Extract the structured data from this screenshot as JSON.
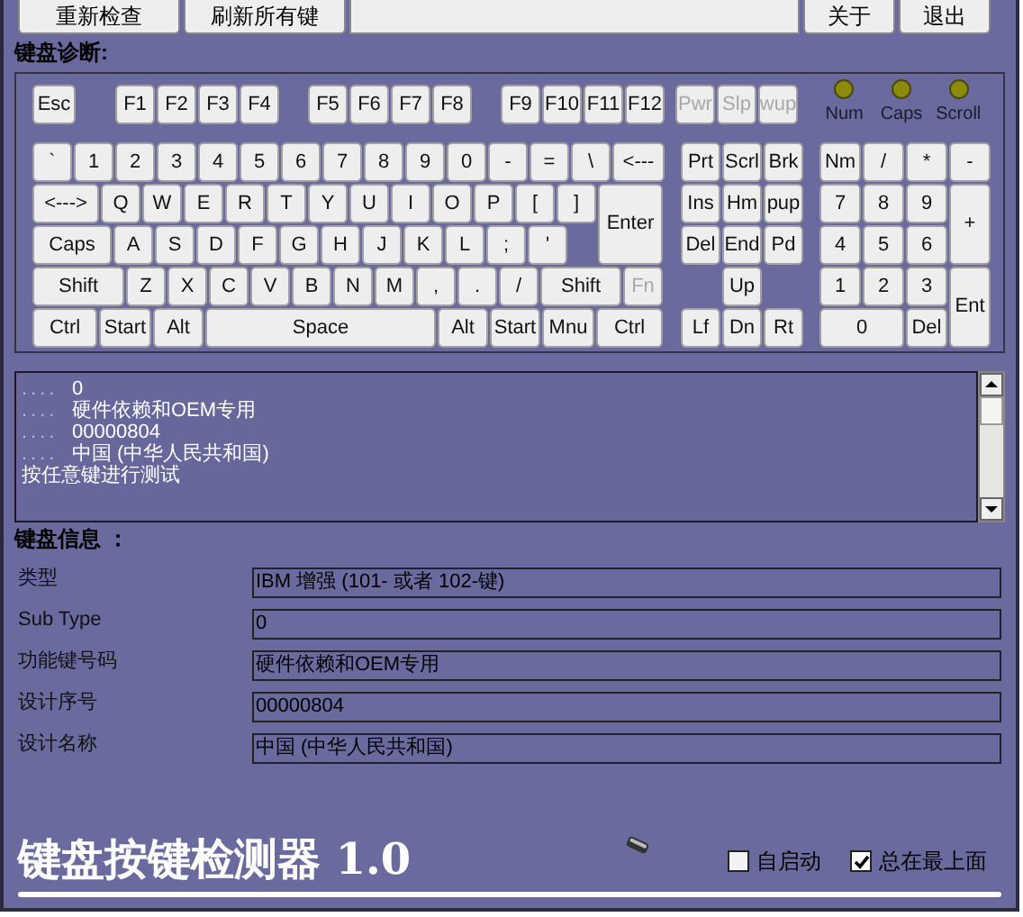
{
  "toolbar": {
    "left_buttons": [
      "重新检查",
      "刷新所有键"
    ],
    "right_buttons": [
      "关于",
      "退出"
    ]
  },
  "diagnostics": {
    "title": "键盘诊断:",
    "function_row": [
      {
        "label": "Esc",
        "disabled": false
      },
      {
        "label": "F1",
        "disabled": false
      },
      {
        "label": "F2",
        "disabled": false
      },
      {
        "label": "F3",
        "disabled": false
      },
      {
        "label": "F4",
        "disabled": false
      },
      {
        "label": "F5",
        "disabled": false
      },
      {
        "label": "F6",
        "disabled": false
      },
      {
        "label": "F7",
        "disabled": false
      },
      {
        "label": "F8",
        "disabled": false
      },
      {
        "label": "F9",
        "disabled": false
      },
      {
        "label": "F10",
        "disabled": false
      },
      {
        "label": "F11",
        "disabled": false
      },
      {
        "label": "F12",
        "disabled": false
      },
      {
        "label": "Pwr",
        "disabled": true
      },
      {
        "label": "Slp",
        "disabled": true
      },
      {
        "label": "wup",
        "disabled": true
      }
    ],
    "indicators": [
      "Num",
      "Caps",
      "Scroll"
    ],
    "main_rows": [
      [
        {
          "label": "`",
          "disabled": false
        },
        {
          "label": "1",
          "disabled": false
        },
        {
          "label": "2",
          "disabled": false
        },
        {
          "label": "3",
          "disabled": false
        },
        {
          "label": "4",
          "disabled": false
        },
        {
          "label": "5",
          "disabled": false
        },
        {
          "label": "6",
          "disabled": false
        },
        {
          "label": "7",
          "disabled": false
        },
        {
          "label": "8",
          "disabled": false
        },
        {
          "label": "9",
          "disabled": false
        },
        {
          "label": "0",
          "disabled": false
        },
        {
          "label": "-",
          "disabled": false
        },
        {
          "label": "=",
          "disabled": false
        },
        {
          "label": "\\",
          "disabled": false
        },
        {
          "label": "<---",
          "disabled": false
        }
      ],
      [
        {
          "label": "<--->",
          "disabled": false
        },
        {
          "label": "Q",
          "disabled": false
        },
        {
          "label": "W",
          "disabled": false
        },
        {
          "label": "E",
          "disabled": false
        },
        {
          "label": "R",
          "disabled": false
        },
        {
          "label": "T",
          "disabled": false
        },
        {
          "label": "Y",
          "disabled": false
        },
        {
          "label": "U",
          "disabled": false
        },
        {
          "label": "I",
          "disabled": false
        },
        {
          "label": "O",
          "disabled": false
        },
        {
          "label": "P",
          "disabled": false
        },
        {
          "label": "[",
          "disabled": false
        },
        {
          "label": "]",
          "disabled": false
        },
        {
          "label": "Enter",
          "disabled": false
        }
      ],
      [
        {
          "label": "Caps",
          "disabled": false
        },
        {
          "label": "A",
          "disabled": false
        },
        {
          "label": "S",
          "disabled": false
        },
        {
          "label": "D",
          "disabled": false
        },
        {
          "label": "F",
          "disabled": false
        },
        {
          "label": "G",
          "disabled": false
        },
        {
          "label": "H",
          "disabled": false
        },
        {
          "label": "J",
          "disabled": false
        },
        {
          "label": "K",
          "disabled": false
        },
        {
          "label": "L",
          "disabled": false
        },
        {
          "label": ";",
          "disabled": false
        },
        {
          "label": "'",
          "disabled": false
        }
      ],
      [
        {
          "label": "Shift",
          "disabled": false
        },
        {
          "label": "Z",
          "disabled": false
        },
        {
          "label": "X",
          "disabled": false
        },
        {
          "label": "C",
          "disabled": false
        },
        {
          "label": "V",
          "disabled": false
        },
        {
          "label": "B",
          "disabled": false
        },
        {
          "label": "N",
          "disabled": false
        },
        {
          "label": "M",
          "disabled": false
        },
        {
          "label": ",",
          "disabled": false
        },
        {
          "label": ".",
          "disabled": false
        },
        {
          "label": "/",
          "disabled": false
        },
        {
          "label": "Shift",
          "disabled": false
        },
        {
          "label": "Fn",
          "disabled": true
        }
      ],
      [
        {
          "label": "Ctrl",
          "disabled": false
        },
        {
          "label": "Start",
          "disabled": false
        },
        {
          "label": "Alt",
          "disabled": false
        },
        {
          "label": "Space",
          "disabled": false
        },
        {
          "label": "Alt",
          "disabled": false
        },
        {
          "label": "Start",
          "disabled": false
        },
        {
          "label": "Mnu",
          "disabled": false
        },
        {
          "label": "Ctrl",
          "disabled": false
        }
      ]
    ],
    "nav_keys": [
      {
        "label": "Prt",
        "disabled": false
      },
      {
        "label": "Scrl",
        "disabled": false
      },
      {
        "label": "Brk",
        "disabled": false
      },
      {
        "label": "Ins",
        "disabled": false
      },
      {
        "label": "Hm",
        "disabled": false
      },
      {
        "label": "pup",
        "disabled": false
      },
      {
        "label": "Del",
        "disabled": false
      },
      {
        "label": "End",
        "disabled": false
      },
      {
        "label": "Pd",
        "disabled": false
      },
      {
        "label": "Up",
        "disabled": false
      },
      {
        "label": "Lf",
        "disabled": false
      },
      {
        "label": "Dn",
        "disabled": false
      },
      {
        "label": "Rt",
        "disabled": false
      }
    ],
    "numpad_keys": [
      {
        "label": "Nm",
        "disabled": false
      },
      {
        "label": "/",
        "disabled": false
      },
      {
        "label": "*",
        "disabled": false
      },
      {
        "label": "-",
        "disabled": false
      },
      {
        "label": "7",
        "disabled": false
      },
      {
        "label": "8",
        "disabled": false
      },
      {
        "label": "9",
        "disabled": false
      },
      {
        "label": "+",
        "disabled": false
      },
      {
        "label": "4",
        "disabled": false
      },
      {
        "label": "5",
        "disabled": false
      },
      {
        "label": "6",
        "disabled": false
      },
      {
        "label": "1",
        "disabled": false
      },
      {
        "label": "2",
        "disabled": false
      },
      {
        "label": "3",
        "disabled": false
      },
      {
        "label": "Ent",
        "disabled": false
      },
      {
        "label": "0",
        "disabled": false
      },
      {
        "label": "Del",
        "disabled": false
      }
    ]
  },
  "log": {
    "lines": [
      {
        "prefix": "....",
        "text": "0"
      },
      {
        "prefix": "....",
        "text": "硬件依赖和OEM专用"
      },
      {
        "prefix": "....",
        "text": "00000804"
      },
      {
        "prefix": "....",
        "text": "中国 (中华人民共和国)"
      },
      {
        "text": "按任意键进行测试"
      }
    ]
  },
  "info": {
    "title": "键盘信息 ：",
    "rows": [
      {
        "label": "类型",
        "value": "IBM 增强 (101- 或者 102-键)"
      },
      {
        "label": "Sub Type",
        "value": "0"
      },
      {
        "label": "功能键号码",
        "value": "硬件依赖和OEM专用"
      },
      {
        "label": "设计序号",
        "value": "00000804"
      },
      {
        "label": "设计名称",
        "value": "中国 (中华人民共和国)"
      }
    ]
  },
  "footer": {
    "app_title": "键盘按键检测器 1.0",
    "checkboxes": [
      {
        "label": "自启动",
        "checked": false
      },
      {
        "label": "总在最上面",
        "checked": true
      }
    ]
  }
}
